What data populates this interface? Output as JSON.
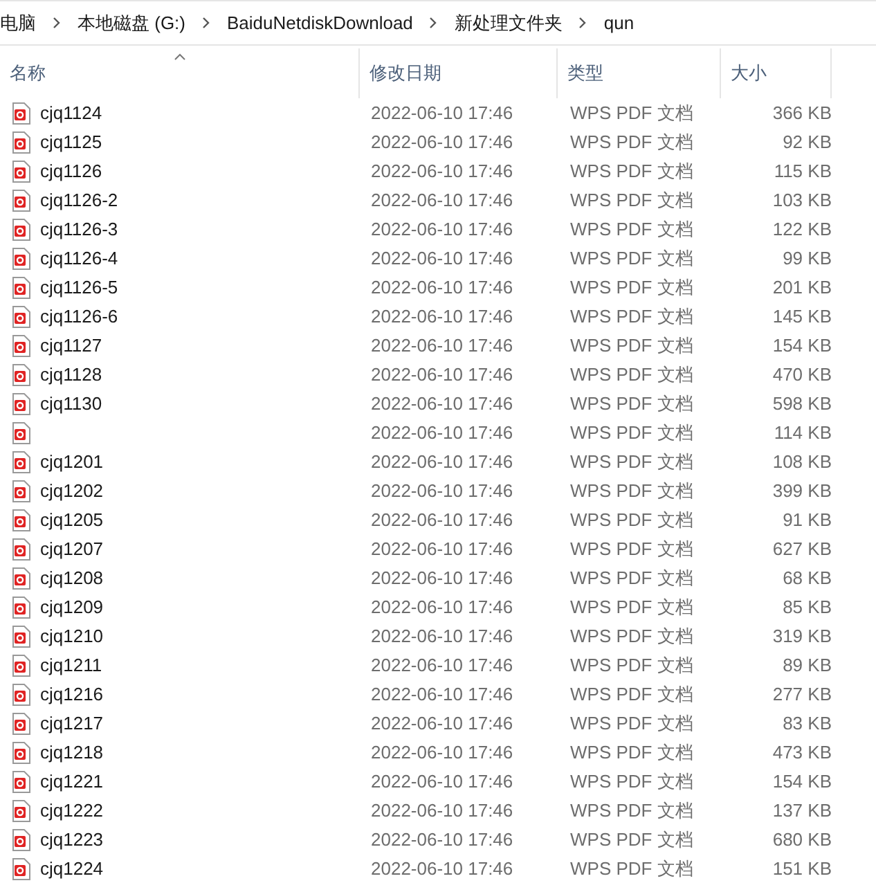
{
  "breadcrumb": [
    "电脑",
    "本地磁盘 (G:)",
    "BaiduNetdiskDownload",
    "新处理文件夹",
    "qun"
  ],
  "columns": [
    {
      "label": "名称",
      "sorted": true
    },
    {
      "label": "修改日期",
      "sorted": false
    },
    {
      "label": "类型",
      "sorted": false
    },
    {
      "label": "大小",
      "sorted": false
    }
  ],
  "rows": [
    {
      "name": "cjq1124",
      "date": "2022-06-10 17:46",
      "type": "WPS PDF 文档",
      "size": "366 KB"
    },
    {
      "name": "cjq1125",
      "date": "2022-06-10 17:46",
      "type": "WPS PDF 文档",
      "size": "92 KB"
    },
    {
      "name": "cjq1126",
      "date": "2022-06-10 17:46",
      "type": "WPS PDF 文档",
      "size": "115 KB"
    },
    {
      "name": "cjq1126-2",
      "date": "2022-06-10 17:46",
      "type": "WPS PDF 文档",
      "size": "103 KB"
    },
    {
      "name": "cjq1126-3",
      "date": "2022-06-10 17:46",
      "type": "WPS PDF 文档",
      "size": "122 KB"
    },
    {
      "name": "cjq1126-4",
      "date": "2022-06-10 17:46",
      "type": "WPS PDF 文档",
      "size": "99 KB"
    },
    {
      "name": "cjq1126-5",
      "date": "2022-06-10 17:46",
      "type": "WPS PDF 文档",
      "size": "201 KB"
    },
    {
      "name": "cjq1126-6",
      "date": "2022-06-10 17:46",
      "type": "WPS PDF 文档",
      "size": "145 KB"
    },
    {
      "name": "cjq1127",
      "date": "2022-06-10 17:46",
      "type": "WPS PDF 文档",
      "size": "154 KB"
    },
    {
      "name": "cjq1128",
      "date": "2022-06-10 17:46",
      "type": "WPS PDF 文档",
      "size": "470 KB"
    },
    {
      "name": "cjq1130",
      "date": "2022-06-10 17:46",
      "type": "WPS PDF 文档",
      "size": "598 KB"
    },
    {
      "date": "2022-06-10 17:46",
      "type": "WPS PDF 文档",
      "size": "114 KB"
    },
    {
      "name": "cjq1201",
      "date": "2022-06-10 17:46",
      "type": "WPS PDF 文档",
      "size": "108 KB"
    },
    {
      "name": "cjq1202",
      "date": "2022-06-10 17:46",
      "type": "WPS PDF 文档",
      "size": "399 KB"
    },
    {
      "name": "cjq1205",
      "date": "2022-06-10 17:46",
      "type": "WPS PDF 文档",
      "size": "91 KB"
    },
    {
      "name": "cjq1207",
      "date": "2022-06-10 17:46",
      "type": "WPS PDF 文档",
      "size": "627 KB"
    },
    {
      "name": "cjq1208",
      "date": "2022-06-10 17:46",
      "type": "WPS PDF 文档",
      "size": "68 KB"
    },
    {
      "name": "cjq1209",
      "date": "2022-06-10 17:46",
      "type": "WPS PDF 文档",
      "size": "85 KB"
    },
    {
      "name": "cjq1210",
      "date": "2022-06-10 17:46",
      "type": "WPS PDF 文档",
      "size": "319 KB"
    },
    {
      "name": "cjq1211",
      "date": "2022-06-10 17:46",
      "type": "WPS PDF 文档",
      "size": "89 KB"
    },
    {
      "name": "cjq1216",
      "date": "2022-06-10 17:46",
      "type": "WPS PDF 文档",
      "size": "277 KB"
    },
    {
      "name": "cjq1217",
      "date": "2022-06-10 17:46",
      "type": "WPS PDF 文档",
      "size": "83 KB"
    },
    {
      "name": "cjq1218",
      "date": "2022-06-10 17:46",
      "type": "WPS PDF 文档",
      "size": "473 KB"
    },
    {
      "name": "cjq1221",
      "date": "2022-06-10 17:46",
      "type": "WPS PDF 文档",
      "size": "154 KB"
    },
    {
      "name": "cjq1222",
      "date": "2022-06-10 17:46",
      "type": "WPS PDF 文档",
      "size": "137 KB"
    },
    {
      "name": "cjq1223",
      "date": "2022-06-10 17:46",
      "type": "WPS PDF 文档",
      "size": "680 KB"
    },
    {
      "name": "cjq1224",
      "date": "2022-06-10 17:46",
      "type": "WPS PDF 文档",
      "size": "151 KB"
    }
  ]
}
